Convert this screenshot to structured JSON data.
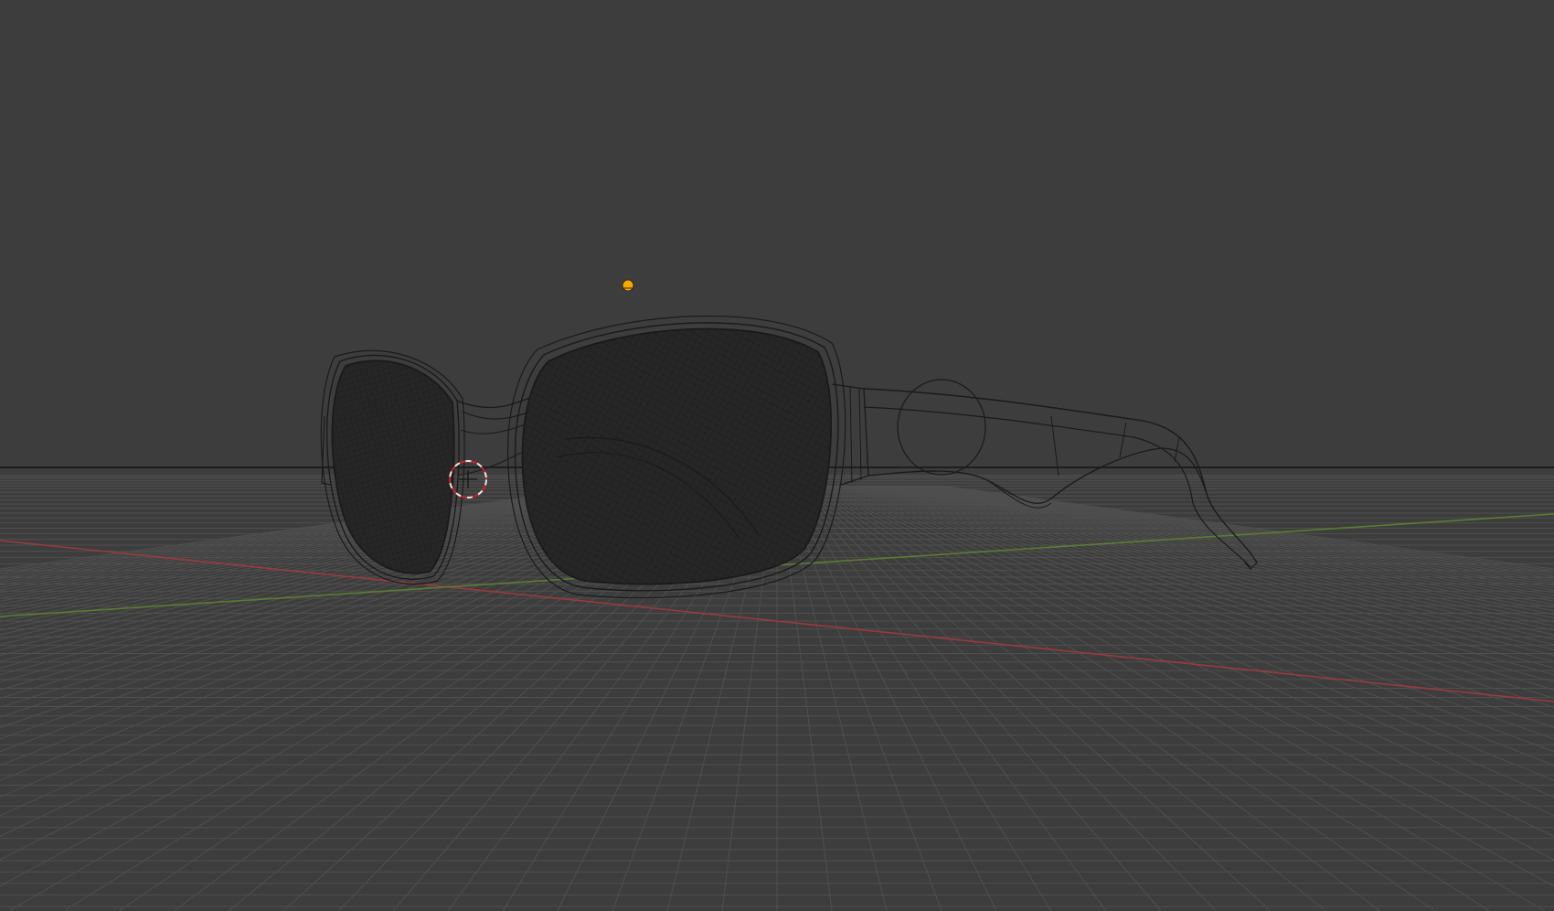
{
  "viewport": {
    "mode": "wireframe",
    "background_color": "#3d3d3d",
    "grid_color": "#4f4f4f",
    "x_axis_color": "#9a3a40",
    "y_axis_color": "#5f7a35",
    "horizon_color": "#141414",
    "wire_color": "#1a1a1a",
    "light_color": "#f5a800"
  },
  "scene": {
    "object": "sunglasses-mesh",
    "gizmos": [
      "light-icon",
      "3d-cursor-icon"
    ]
  }
}
